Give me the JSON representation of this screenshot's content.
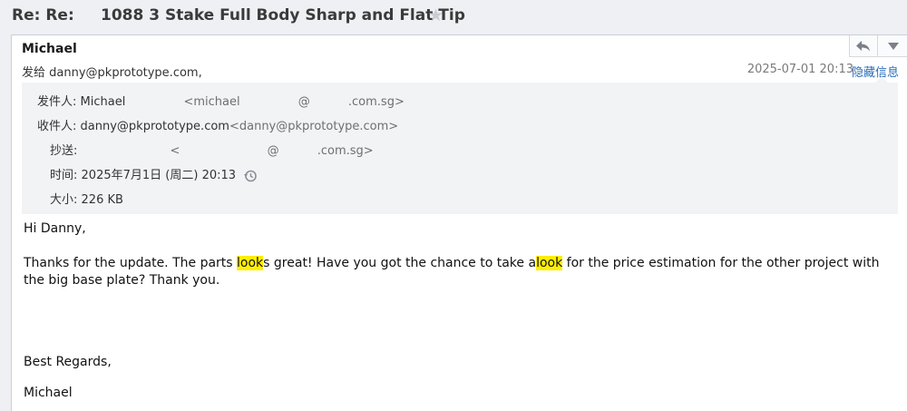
{
  "subject": {
    "prefix": "Re: Re:",
    "title": "1088 3 Stake Full Body Sharp and Flat Tip"
  },
  "header": {
    "sender_name": "Michael",
    "sent_to_label": "发给",
    "sent_to_address": "danny@pkprototype.com,",
    "date": "2025-07-01 20:13",
    "hide_info_label": "隐藏信息"
  },
  "details": {
    "from_label": "发件人:",
    "from_name": "Michael",
    "from_open": "<michael",
    "from_at": "@",
    "from_domain": ".com.sg>",
    "to_label": "收件人:",
    "to_name": "danny@pkprototype.com",
    "to_address": "<danny@pkprototype.com>",
    "cc_label": "抄送:",
    "cc_open": "<",
    "cc_at": "@",
    "cc_domain": ".com.sg>",
    "time_label": "时间:",
    "time_value": "2025年7月1日 (周二) 20:13",
    "size_label": "大小:",
    "size_value": "226 KB"
  },
  "body": {
    "greeting": "Hi Danny,",
    "line1_a": "Thanks for the update. The parts ",
    "line1_hl1": "look",
    "line1_b": "s great! Have you got the chance to take a",
    "line1_hl2": "look",
    "line1_c": " for the price estimation for the other project with",
    "line2": "the big base plate? Thank you.",
    "closing": "Best Regards,",
    "signature": "Michael"
  }
}
